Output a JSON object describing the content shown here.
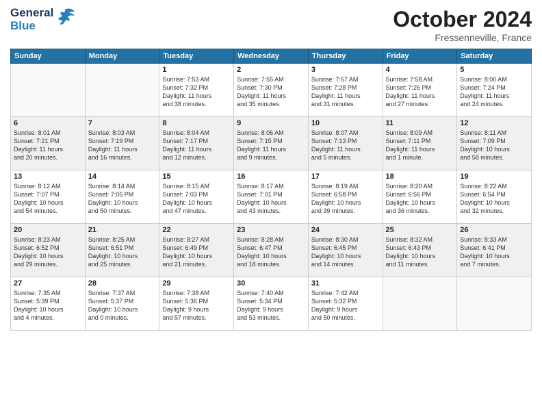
{
  "logo": {
    "line1": "General",
    "line2": "Blue"
  },
  "title": "October 2024",
  "location": "Fressenneville, France",
  "headers": [
    "Sunday",
    "Monday",
    "Tuesday",
    "Wednesday",
    "Thursday",
    "Friday",
    "Saturday"
  ],
  "weeks": [
    [
      {
        "day": "",
        "info": ""
      },
      {
        "day": "",
        "info": ""
      },
      {
        "day": "1",
        "info": "Sunrise: 7:53 AM\nSunset: 7:32 PM\nDaylight: 11 hours\nand 38 minutes."
      },
      {
        "day": "2",
        "info": "Sunrise: 7:55 AM\nSunset: 7:30 PM\nDaylight: 11 hours\nand 35 minutes."
      },
      {
        "day": "3",
        "info": "Sunrise: 7:57 AM\nSunset: 7:28 PM\nDaylight: 11 hours\nand 31 minutes."
      },
      {
        "day": "4",
        "info": "Sunrise: 7:58 AM\nSunset: 7:26 PM\nDaylight: 11 hours\nand 27 minutes."
      },
      {
        "day": "5",
        "info": "Sunrise: 8:00 AM\nSunset: 7:24 PM\nDaylight: 11 hours\nand 24 minutes."
      }
    ],
    [
      {
        "day": "6",
        "info": "Sunrise: 8:01 AM\nSunset: 7:21 PM\nDaylight: 11 hours\nand 20 minutes."
      },
      {
        "day": "7",
        "info": "Sunrise: 8:03 AM\nSunset: 7:19 PM\nDaylight: 11 hours\nand 16 minutes."
      },
      {
        "day": "8",
        "info": "Sunrise: 8:04 AM\nSunset: 7:17 PM\nDaylight: 11 hours\nand 12 minutes."
      },
      {
        "day": "9",
        "info": "Sunrise: 8:06 AM\nSunset: 7:15 PM\nDaylight: 11 hours\nand 9 minutes."
      },
      {
        "day": "10",
        "info": "Sunrise: 8:07 AM\nSunset: 7:13 PM\nDaylight: 11 hours\nand 5 minutes."
      },
      {
        "day": "11",
        "info": "Sunrise: 8:09 AM\nSunset: 7:11 PM\nDaylight: 11 hours\nand 1 minute."
      },
      {
        "day": "12",
        "info": "Sunrise: 8:11 AM\nSunset: 7:09 PM\nDaylight: 10 hours\nand 58 minutes."
      }
    ],
    [
      {
        "day": "13",
        "info": "Sunrise: 8:12 AM\nSunset: 7:07 PM\nDaylight: 10 hours\nand 54 minutes."
      },
      {
        "day": "14",
        "info": "Sunrise: 8:14 AM\nSunset: 7:05 PM\nDaylight: 10 hours\nand 50 minutes."
      },
      {
        "day": "15",
        "info": "Sunrise: 8:15 AM\nSunset: 7:03 PM\nDaylight: 10 hours\nand 47 minutes."
      },
      {
        "day": "16",
        "info": "Sunrise: 8:17 AM\nSunset: 7:01 PM\nDaylight: 10 hours\nand 43 minutes."
      },
      {
        "day": "17",
        "info": "Sunrise: 8:19 AM\nSunset: 6:58 PM\nDaylight: 10 hours\nand 39 minutes."
      },
      {
        "day": "18",
        "info": "Sunrise: 8:20 AM\nSunset: 6:56 PM\nDaylight: 10 hours\nand 36 minutes."
      },
      {
        "day": "19",
        "info": "Sunrise: 8:22 AM\nSunset: 6:54 PM\nDaylight: 10 hours\nand 32 minutes."
      }
    ],
    [
      {
        "day": "20",
        "info": "Sunrise: 8:23 AM\nSunset: 6:52 PM\nDaylight: 10 hours\nand 29 minutes."
      },
      {
        "day": "21",
        "info": "Sunrise: 8:25 AM\nSunset: 6:51 PM\nDaylight: 10 hours\nand 25 minutes."
      },
      {
        "day": "22",
        "info": "Sunrise: 8:27 AM\nSunset: 6:49 PM\nDaylight: 10 hours\nand 21 minutes."
      },
      {
        "day": "23",
        "info": "Sunrise: 8:28 AM\nSunset: 6:47 PM\nDaylight: 10 hours\nand 18 minutes."
      },
      {
        "day": "24",
        "info": "Sunrise: 8:30 AM\nSunset: 6:45 PM\nDaylight: 10 hours\nand 14 minutes."
      },
      {
        "day": "25",
        "info": "Sunrise: 8:32 AM\nSunset: 6:43 PM\nDaylight: 10 hours\nand 11 minutes."
      },
      {
        "day": "26",
        "info": "Sunrise: 8:33 AM\nSunset: 6:41 PM\nDaylight: 10 hours\nand 7 minutes."
      }
    ],
    [
      {
        "day": "27",
        "info": "Sunrise: 7:35 AM\nSunset: 5:39 PM\nDaylight: 10 hours\nand 4 minutes."
      },
      {
        "day": "28",
        "info": "Sunrise: 7:37 AM\nSunset: 5:37 PM\nDaylight: 10 hours\nand 0 minutes."
      },
      {
        "day": "29",
        "info": "Sunrise: 7:38 AM\nSunset: 5:36 PM\nDaylight: 9 hours\nand 57 minutes."
      },
      {
        "day": "30",
        "info": "Sunrise: 7:40 AM\nSunset: 5:34 PM\nDaylight: 9 hours\nand 53 minutes."
      },
      {
        "day": "31",
        "info": "Sunrise: 7:42 AM\nSunset: 5:32 PM\nDaylight: 9 hours\nand 50 minutes."
      },
      {
        "day": "",
        "info": ""
      },
      {
        "day": "",
        "info": ""
      }
    ]
  ]
}
